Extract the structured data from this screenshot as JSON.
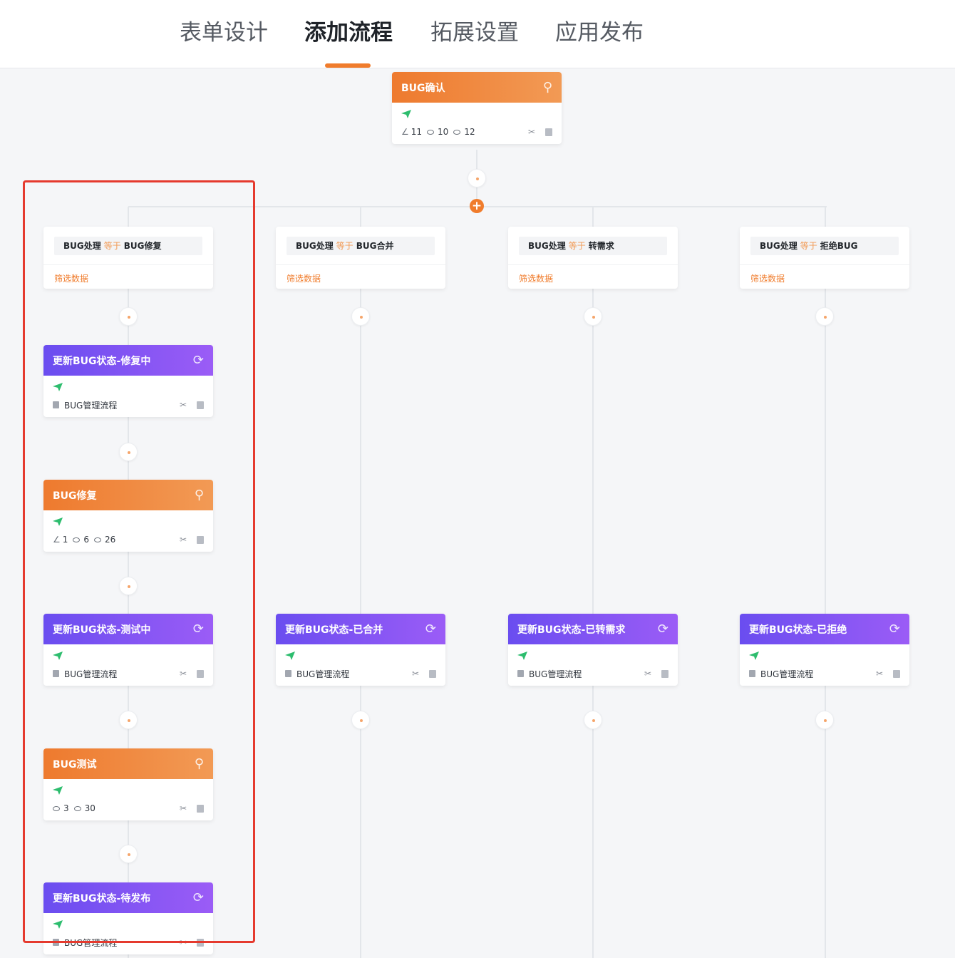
{
  "tabs": [
    {
      "label": "表单设计"
    },
    {
      "label": "添加流程"
    },
    {
      "label": "拓展设置"
    },
    {
      "label": "应用发布"
    }
  ],
  "active_tab": "添加流程",
  "colors": {
    "accent": "#f07c2c",
    "purple": "#7b52f3",
    "highlight": "#e53a2e",
    "send_green": "#2dbd6e"
  },
  "root_node": {
    "title": "BUG确认",
    "icon": "approver-stamp-icon",
    "stats": [
      "11",
      "10",
      "12"
    ]
  },
  "branches": [
    {
      "condition": {
        "field": "BUG处理",
        "operator": "等于",
        "value": "BUG修复",
        "filter_link": "筛选数据"
      },
      "nodes": [
        {
          "type": "update",
          "title": "更新BUG状态-修复中",
          "source": "BUG管理流程"
        },
        {
          "type": "approve",
          "title": "BUG修复",
          "stats": [
            "1",
            "6",
            "26"
          ]
        },
        {
          "type": "update",
          "title": "更新BUG状态-测试中",
          "source": "BUG管理流程"
        },
        {
          "type": "approve",
          "title": "BUG测试",
          "stats": [
            "3",
            "30"
          ]
        },
        {
          "type": "update",
          "title": "更新BUG状态-待发布",
          "source": "BUG管理流程"
        }
      ]
    },
    {
      "condition": {
        "field": "BUG处理",
        "operator": "等于",
        "value": "BUG合并",
        "filter_link": "筛选数据"
      },
      "nodes": [
        {
          "type": "update",
          "title": "更新BUG状态-已合并",
          "source": "BUG管理流程"
        }
      ]
    },
    {
      "condition": {
        "field": "BUG处理",
        "operator": "等于",
        "value": "转需求",
        "filter_link": "筛选数据"
      },
      "nodes": [
        {
          "type": "update",
          "title": "更新BUG状态-已转需求",
          "source": "BUG管理流程"
        }
      ]
    },
    {
      "condition": {
        "field": "BUG处理",
        "operator": "等于",
        "value": "拒绝BUG",
        "filter_link": "筛选数据"
      },
      "nodes": [
        {
          "type": "update",
          "title": "更新BUG状态-已拒绝",
          "source": "BUG管理流程"
        }
      ]
    }
  ]
}
